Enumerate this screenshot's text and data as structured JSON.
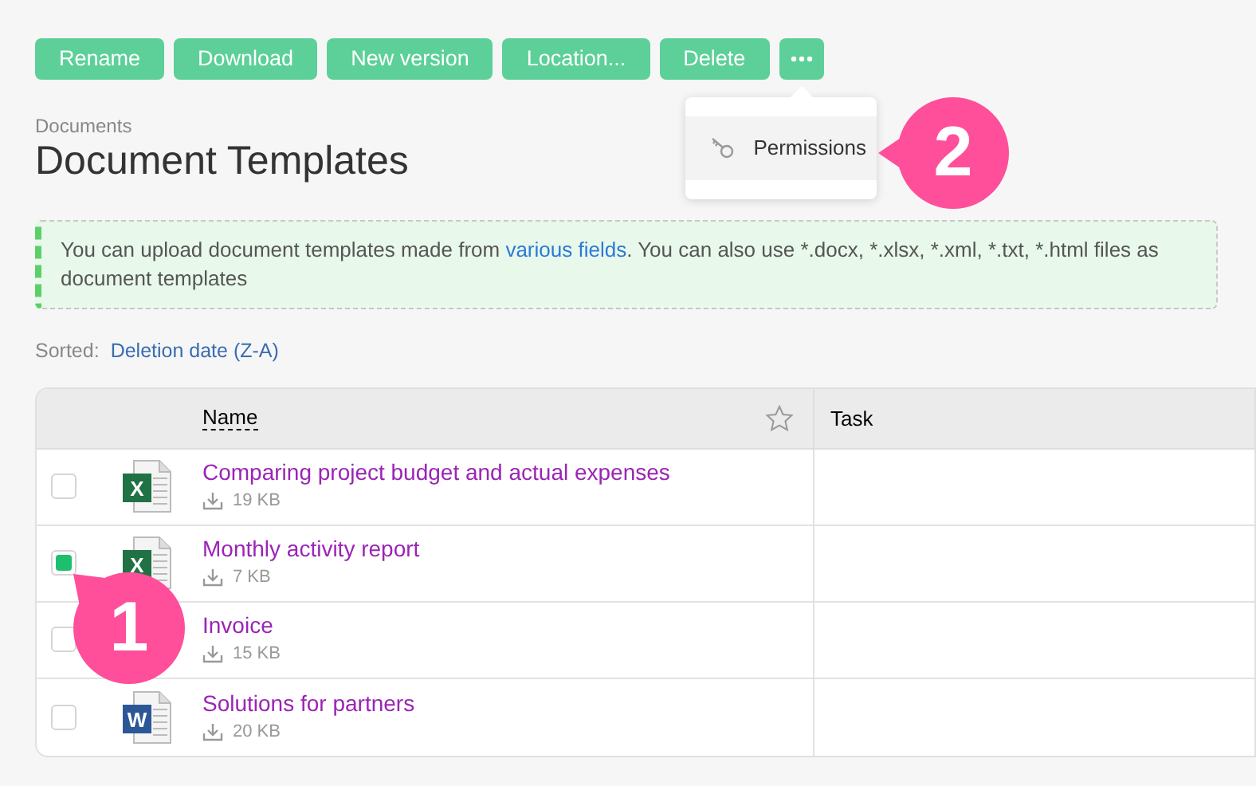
{
  "toolbar": {
    "buttons": [
      "Rename",
      "Download",
      "New version",
      "Location...",
      "Delete"
    ],
    "more_menu": {
      "items": [
        {
          "label": "Permissions",
          "highlighted": true
        }
      ]
    }
  },
  "breadcrumb": "Documents",
  "title": "Document Templates",
  "notice": {
    "text_before": "You can upload document templates made from ",
    "link": "various fields",
    "text_after": ". You can also use *.docx, *.xlsx, *.xml, *.txt, *.html files as document templates"
  },
  "sort": {
    "label": "Sorted:",
    "value": "Deletion date (Z-A)"
  },
  "table": {
    "columns": [
      "Name",
      "Task"
    ],
    "rows": [
      {
        "checked": false,
        "kind": "excel",
        "icon_letter": "X",
        "name": "Comparing project budget and actual expenses",
        "size": "19 KB"
      },
      {
        "checked": true,
        "kind": "excel",
        "icon_letter": "X",
        "name": "Monthly activity report",
        "size": "7 KB"
      },
      {
        "checked": false,
        "name": "Invoice",
        "size": "15 KB"
      },
      {
        "checked": false,
        "kind": "word",
        "icon_letter": "W",
        "name": "Solutions for partners",
        "size": "20 KB"
      }
    ]
  },
  "callouts": [
    {
      "number": "1"
    },
    {
      "number": "2"
    }
  ]
}
